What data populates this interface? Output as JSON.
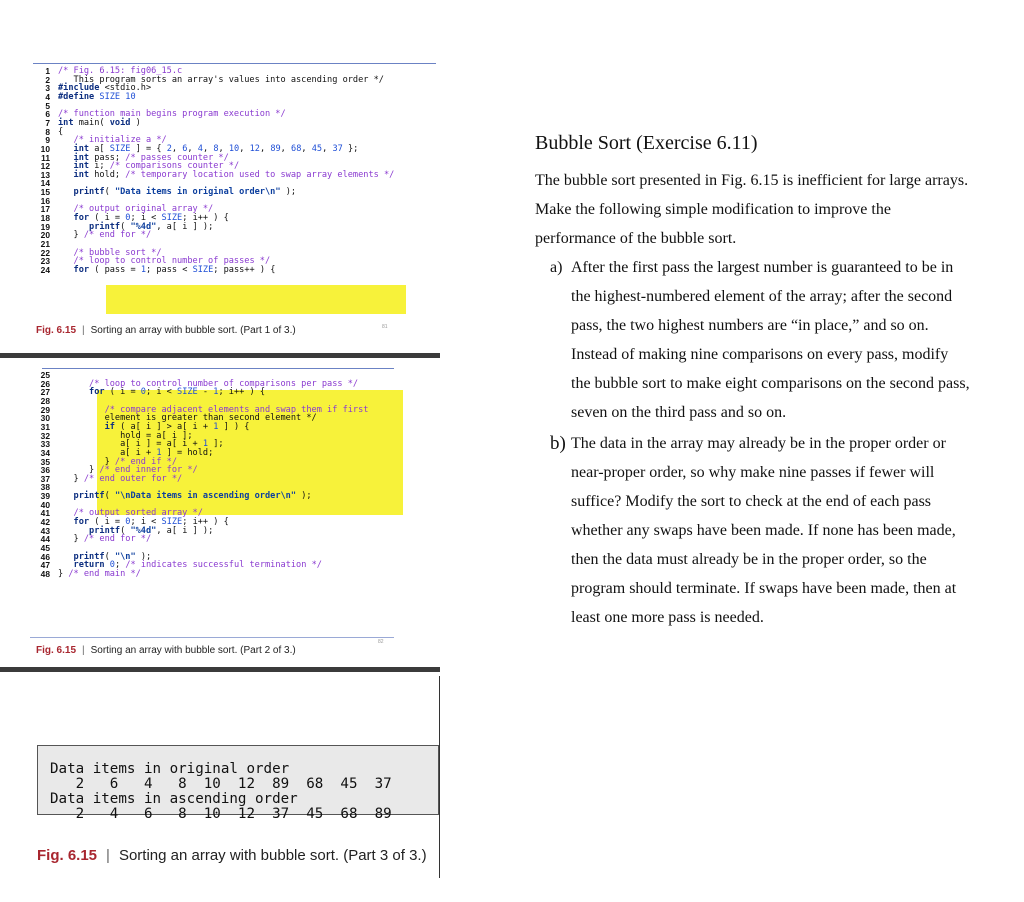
{
  "part1": {
    "lines": [
      {
        "n": "1",
        "t": "/* Fig. 6.15: fig06_15.c"
      },
      {
        "n": "2",
        "t": "   This program sorts an array's values into ascending order */"
      },
      {
        "n": "3",
        "t": "#include <stdio.h>"
      },
      {
        "n": "4",
        "t": "#define SIZE 10"
      },
      {
        "n": "5",
        "t": ""
      },
      {
        "n": "6",
        "t": "/* function main begins program execution */"
      },
      {
        "n": "7",
        "t": "int main( void )"
      },
      {
        "n": "8",
        "t": "{"
      },
      {
        "n": "9",
        "t": "   /* initialize a */"
      },
      {
        "n": "10",
        "t": "   int a[ SIZE ] = { 2, 6, 4, 8, 10, 12, 89, 68, 45, 37 };"
      },
      {
        "n": "11",
        "t": "   int pass; /* passes counter */"
      },
      {
        "n": "12",
        "t": "   int i; /* comparisons counter */"
      },
      {
        "n": "13",
        "t": "   int hold; /* temporary location used to swap array elements */"
      },
      {
        "n": "14",
        "t": ""
      },
      {
        "n": "15",
        "t": "   printf( \"Data items in original order\\n\" );"
      },
      {
        "n": "16",
        "t": ""
      },
      {
        "n": "17",
        "t": "   /* output original array */"
      },
      {
        "n": "18",
        "t": "   for ( i = 0; i < SIZE; i++ ) {"
      },
      {
        "n": "19",
        "t": "      printf( \"%4d\", a[ i ] );"
      },
      {
        "n": "20",
        "t": "   } /* end for */"
      },
      {
        "n": "21",
        "t": ""
      },
      {
        "n": "22",
        "t": "   /* bubble sort */"
      },
      {
        "n": "23",
        "t": "   /* loop to control number of passes */"
      },
      {
        "n": "24",
        "t": "   for ( pass = 1; pass < SIZE; pass++ ) {"
      }
    ],
    "caption_fig": "Fig. 6.15",
    "caption_text": "Sorting an array with bubble sort. (Part 1 of 3.)",
    "page": "81"
  },
  "part2": {
    "lines": [
      {
        "n": "25",
        "t": ""
      },
      {
        "n": "26",
        "t": "      /* loop to control number of comparisons per pass */"
      },
      {
        "n": "27",
        "t": "      for ( i = 0; i < SIZE - 1; i++ ) {"
      },
      {
        "n": "28",
        "t": ""
      },
      {
        "n": "29",
        "t": "         /* compare adjacent elements and swap them if first"
      },
      {
        "n": "30",
        "t": "         element is greater than second element */"
      },
      {
        "n": "31",
        "t": "         if ( a[ i ] > a[ i + 1 ] ) {"
      },
      {
        "n": "32",
        "t": "            hold = a[ i ];"
      },
      {
        "n": "33",
        "t": "            a[ i ] = a[ i + 1 ];"
      },
      {
        "n": "34",
        "t": "            a[ i + 1 ] = hold;"
      },
      {
        "n": "35",
        "t": "         } /* end if */"
      },
      {
        "n": "36",
        "t": "      } /* end inner for */"
      },
      {
        "n": "37",
        "t": "   } /* end outer for */"
      },
      {
        "n": "38",
        "t": ""
      },
      {
        "n": "39",
        "t": "   printf( \"\\nData items in ascending order\\n\" );"
      },
      {
        "n": "40",
        "t": ""
      },
      {
        "n": "41",
        "t": "   /* output sorted array */"
      },
      {
        "n": "42",
        "t": "   for ( i = 0; i < SIZE; i++ ) {"
      },
      {
        "n": "43",
        "t": "      printf( \"%4d\", a[ i ] );"
      },
      {
        "n": "44",
        "t": "   } /* end for */"
      },
      {
        "n": "45",
        "t": ""
      },
      {
        "n": "46",
        "t": "   printf( \"\\n\" );"
      },
      {
        "n": "47",
        "t": "   return 0; /* indicates successful termination */"
      },
      {
        "n": "48",
        "t": "} /* end main */"
      }
    ],
    "caption_fig": "Fig. 6.15",
    "caption_text": "Sorting an array with bubble sort. (Part 2 of 3.)",
    "page": "82"
  },
  "part3": {
    "output_lines": [
      "Data items in original order",
      "   2   6   4   8  10  12  89  68  45  37",
      "Data items in ascending order",
      "   2   4   6   8  10  12  37  45  68  89"
    ],
    "caption_fig": "Fig. 6.15",
    "caption_text": "Sorting an array with bubble sort. (Part 3 of 3.)"
  },
  "exercise": {
    "title": "Bubble Sort (Exercise 6.11)",
    "intro": [
      "The bubble sort presented in Fig. 6.15 is inefficient for large arrays.",
      "Make the following simple modification to improve the",
      "performance of the bubble sort."
    ],
    "a_label": "a)",
    "a_lines": [
      "After the first pass the largest number is guaranteed to be in",
      "the highest-numbered element of the array; after the second",
      "pass, the two highest numbers are “in place,” and so on.",
      "Instead of making nine comparisons on every pass, modify",
      "the bubble sort to make eight comparisons on the second pass,",
      "seven on the third pass and so on."
    ],
    "b_label": "b)",
    "b_lines": [
      "The data in the array may already be in the proper order or",
      "near-proper order, so why make nine passes if fewer will",
      "suffice? Modify the sort to check at the end of each pass",
      "whether any swaps have been made. If none has been made,",
      "then the data must already be in the proper order, so the",
      "program should terminate. If swaps have been made, then at",
      "least one more pass is needed."
    ]
  }
}
